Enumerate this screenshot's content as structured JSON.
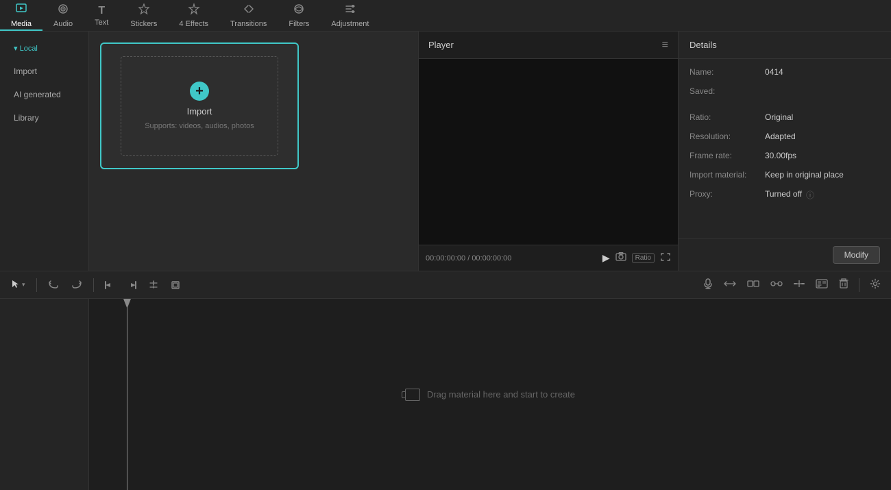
{
  "topNav": {
    "items": [
      {
        "id": "media",
        "label": "Media",
        "icon": "▶",
        "active": true
      },
      {
        "id": "audio",
        "label": "Audio",
        "icon": "◎"
      },
      {
        "id": "text",
        "label": "Text",
        "icon": "T"
      },
      {
        "id": "stickers",
        "label": "Stickers",
        "icon": "★"
      },
      {
        "id": "effects",
        "label": "Effects",
        "icon": "✦",
        "badge": "4"
      },
      {
        "id": "transitions",
        "label": "Transitions",
        "icon": "⇄"
      },
      {
        "id": "filters",
        "label": "Filters",
        "icon": "⊕"
      },
      {
        "id": "adjustment",
        "label": "Adjustment",
        "icon": "⊞"
      }
    ]
  },
  "leftPanel": {
    "items": [
      {
        "id": "local",
        "label": "▾ Local",
        "active": true,
        "isHeader": true
      },
      {
        "id": "import",
        "label": "Import"
      },
      {
        "id": "ai-generated",
        "label": "AI generated"
      },
      {
        "id": "library",
        "label": "Library"
      }
    ]
  },
  "importBox": {
    "label": "Import",
    "subtext": "Supports: videos, audios, photos"
  },
  "player": {
    "title": "Player",
    "timeLeft": "00:00:00:00",
    "timeRight": "00:00:00:00",
    "ratioLabel": "Ratio"
  },
  "details": {
    "title": "Details",
    "rows": [
      {
        "label": "Name:",
        "value": "0414"
      },
      {
        "label": "Saved:",
        "value": ""
      },
      {
        "label": "Ratio:",
        "value": "Original"
      },
      {
        "label": "Resolution:",
        "value": "Adapted"
      },
      {
        "label": "Frame rate:",
        "value": "30.00fps"
      },
      {
        "label": "Import material:",
        "value": "Keep in original place"
      },
      {
        "label": "Proxy:",
        "value": "Turned off",
        "hasInfo": true
      }
    ],
    "modifyLabel": "Modify"
  },
  "timeline": {
    "dragHint": "Drag material here and start to create",
    "tools": {
      "selectLabel": "▷",
      "selectArrow": "▾",
      "undoIcon": "↩",
      "redoIcon": "↪",
      "trimLeft": "⊣",
      "trimRight": "⊢",
      "splitIcon": "⋮",
      "cropIcon": "⊡"
    },
    "rightTools": [
      "🎤",
      "⇔",
      "⊞",
      "⇔",
      "⊠",
      "🖼",
      "⊘",
      "🗑"
    ]
  }
}
